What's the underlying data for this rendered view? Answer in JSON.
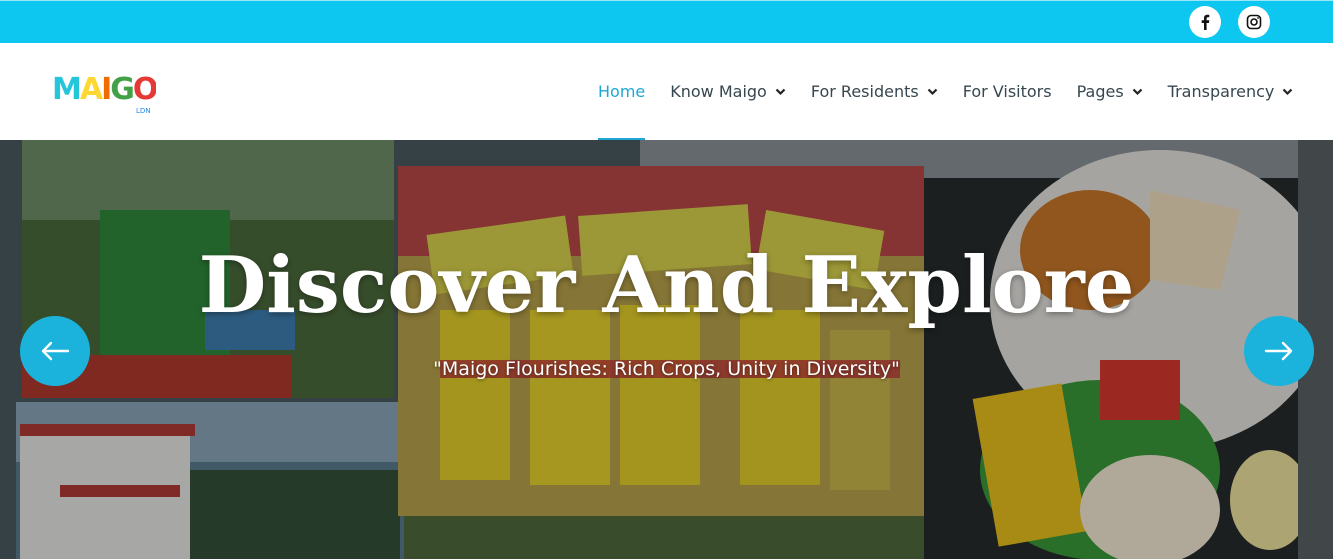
{
  "colors": {
    "topbar": "#0dc7f0",
    "accent": "#1ea7d4",
    "arrow_button": "#1bb3dc",
    "nav_text": "#37474f"
  },
  "topbar": {
    "social": [
      {
        "icon": "facebook-icon"
      },
      {
        "icon": "instagram-icon"
      }
    ]
  },
  "header": {
    "logo_text": "MAIGO",
    "logo_subtext": "LDN",
    "nav": [
      {
        "label": "Home",
        "active": true,
        "dropdown": false
      },
      {
        "label": "Know Maigo",
        "active": false,
        "dropdown": true
      },
      {
        "label": "For Residents",
        "active": false,
        "dropdown": true
      },
      {
        "label": "For Visitors",
        "active": false,
        "dropdown": false
      },
      {
        "label": "Pages",
        "active": false,
        "dropdown": true
      },
      {
        "label": "Transparency",
        "active": false,
        "dropdown": true
      }
    ]
  },
  "hero": {
    "title": "Discover And Explore",
    "subtitle": "\"Maigo Flourishes: Rich Crops, Unity in Diversity\"",
    "prev_icon": "arrow-left-icon",
    "next_icon": "arrow-right-icon"
  }
}
